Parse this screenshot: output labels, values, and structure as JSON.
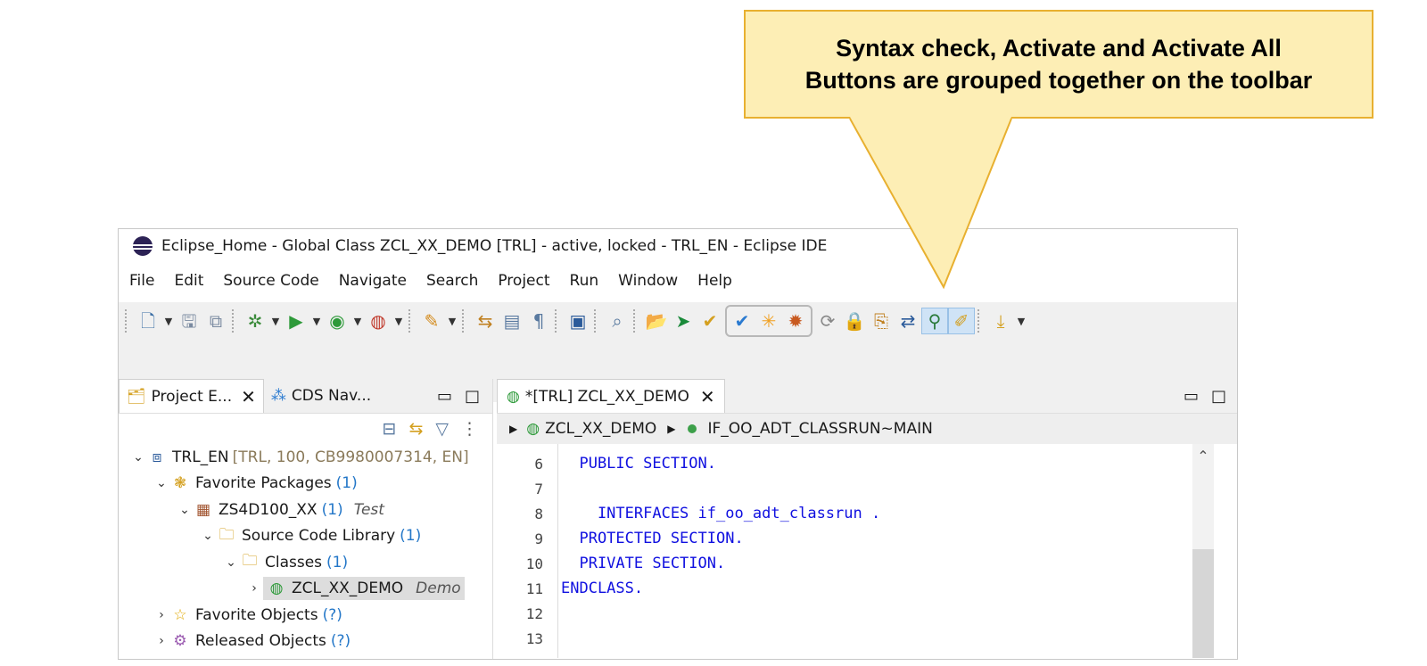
{
  "callout": {
    "line1": "Syntax check, Activate and Activate All",
    "line2": "Buttons are grouped together on the toolbar",
    "fill_color": "#fdeeb5",
    "border_color": "#e8b030"
  },
  "window": {
    "title": "Eclipse_Home - Global Class ZCL_XX_DEMO [TRL]  - active, locked - TRL_EN - Eclipse IDE"
  },
  "menu": [
    "File",
    "Edit",
    "Source Code",
    "Navigate",
    "Search",
    "Project",
    "Run",
    "Window",
    "Help"
  ],
  "toolbar": {
    "group_highlight": [
      "check-syntax-icon",
      "activate-icon",
      "activate-all-icon"
    ]
  },
  "left_pane": {
    "tabs": [
      {
        "label": "Project E...",
        "close": "✕"
      },
      {
        "label": "CDS Nav...",
        "close": ""
      }
    ],
    "tree": [
      {
        "name": "TRL_EN",
        "detail": "[TRL, 100, CB9980007314, EN]"
      },
      {
        "name": "Favorite Packages",
        "count": "(1)"
      },
      {
        "name": "ZS4D100_XX",
        "count": "(1)",
        "desc": "Test"
      },
      {
        "name": "Source Code Library",
        "count": "(1)"
      },
      {
        "name": "Classes",
        "count": "(1)"
      },
      {
        "name": "ZCL_XX_DEMO",
        "desc": "Demo"
      },
      {
        "name": "Favorite Objects",
        "count": "(?)"
      },
      {
        "name": "Released Objects",
        "count": "(?)"
      }
    ]
  },
  "editor": {
    "tab_label": "*[TRL] ZCL_XX_DEMO",
    "breadcrumb": {
      "class": "ZCL_XX_DEMO",
      "method": "IF_OO_ADT_CLASSRUN~MAIN"
    },
    "lines": [
      {
        "num": "6",
        "text": "  PUBLIC SECTION."
      },
      {
        "num": "7",
        "text": ""
      },
      {
        "num": "8",
        "text": "    INTERFACES if_oo_adt_classrun ."
      },
      {
        "num": "9",
        "text": "  PROTECTED SECTION."
      },
      {
        "num": "10",
        "text": "  PRIVATE SECTION."
      },
      {
        "num": "11",
        "text": "ENDCLASS."
      },
      {
        "num": "12",
        "text": ""
      },
      {
        "num": "13",
        "text": ""
      }
    ]
  }
}
